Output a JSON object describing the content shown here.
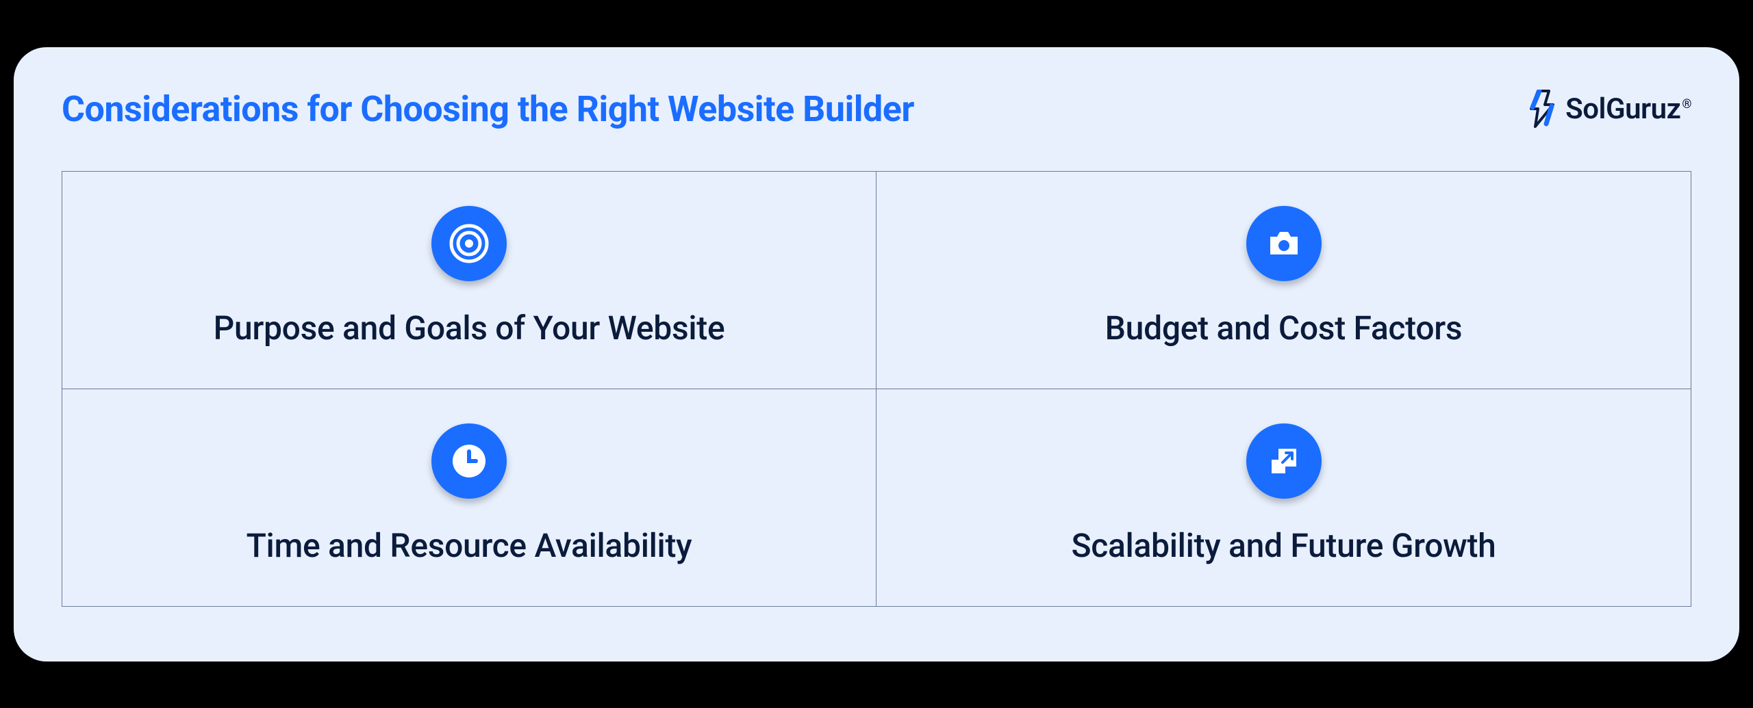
{
  "title": "Considerations for Choosing the Right Website Builder",
  "brand": {
    "name": "SolGuruz",
    "registered": "®"
  },
  "items": [
    {
      "label": "Purpose and Goals of Your Website",
      "icon": "target-icon"
    },
    {
      "label": "Budget and Cost Factors",
      "icon": "camera-icon"
    },
    {
      "label": "Time and Resource Availability",
      "icon": "clock-icon"
    },
    {
      "label": "Scalability and Future Growth",
      "icon": "expand-icon"
    }
  ]
}
